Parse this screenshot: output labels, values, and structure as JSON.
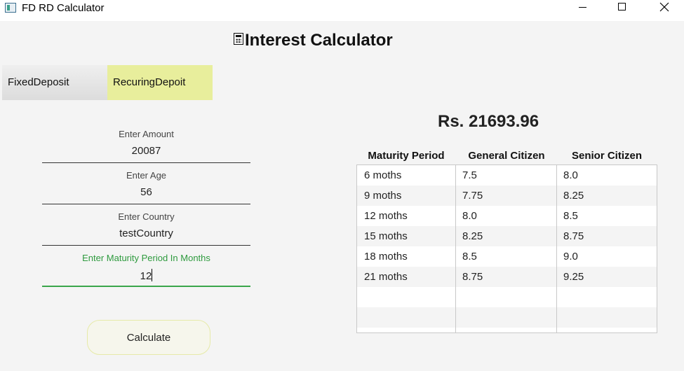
{
  "window": {
    "title": "FD RD Calculator"
  },
  "heading": "Interest Calculator",
  "tabs": [
    {
      "label": "FixedDeposit",
      "selected": false
    },
    {
      "label": "RecuringDepoit",
      "selected": true
    }
  ],
  "form": {
    "amount": {
      "label": "Enter Amount",
      "value": "20087"
    },
    "age": {
      "label": "Enter Age",
      "value": "56"
    },
    "country": {
      "label": "Enter Country",
      "value": "testCountry"
    },
    "maturity": {
      "label": "Enter Maturity Period In Months",
      "value": "12"
    },
    "calculate_label": "Calculate"
  },
  "result": "Rs. 21693.96",
  "rates_table": {
    "headers": [
      "Maturity Period",
      "General Citizen",
      "Senior Citizen"
    ],
    "rows": [
      [
        "6 moths",
        "7.5",
        "8.0"
      ],
      [
        "9 moths",
        "7.75",
        "8.25"
      ],
      [
        "12 moths",
        "8.0",
        "8.5"
      ],
      [
        "15 moths",
        "8.25",
        "8.75"
      ],
      [
        "18 moths",
        "8.5",
        "9.0"
      ],
      [
        "21 moths",
        "8.75",
        "9.25"
      ]
    ]
  },
  "colors": {
    "tab_selected": "#e8ee9c",
    "focus_green": "#3aa64a",
    "button_border": "#e6eaa8"
  },
  "icons": [
    "app-icon",
    "calculator-icon",
    "minimize-icon",
    "maximize-icon",
    "close-icon"
  ]
}
